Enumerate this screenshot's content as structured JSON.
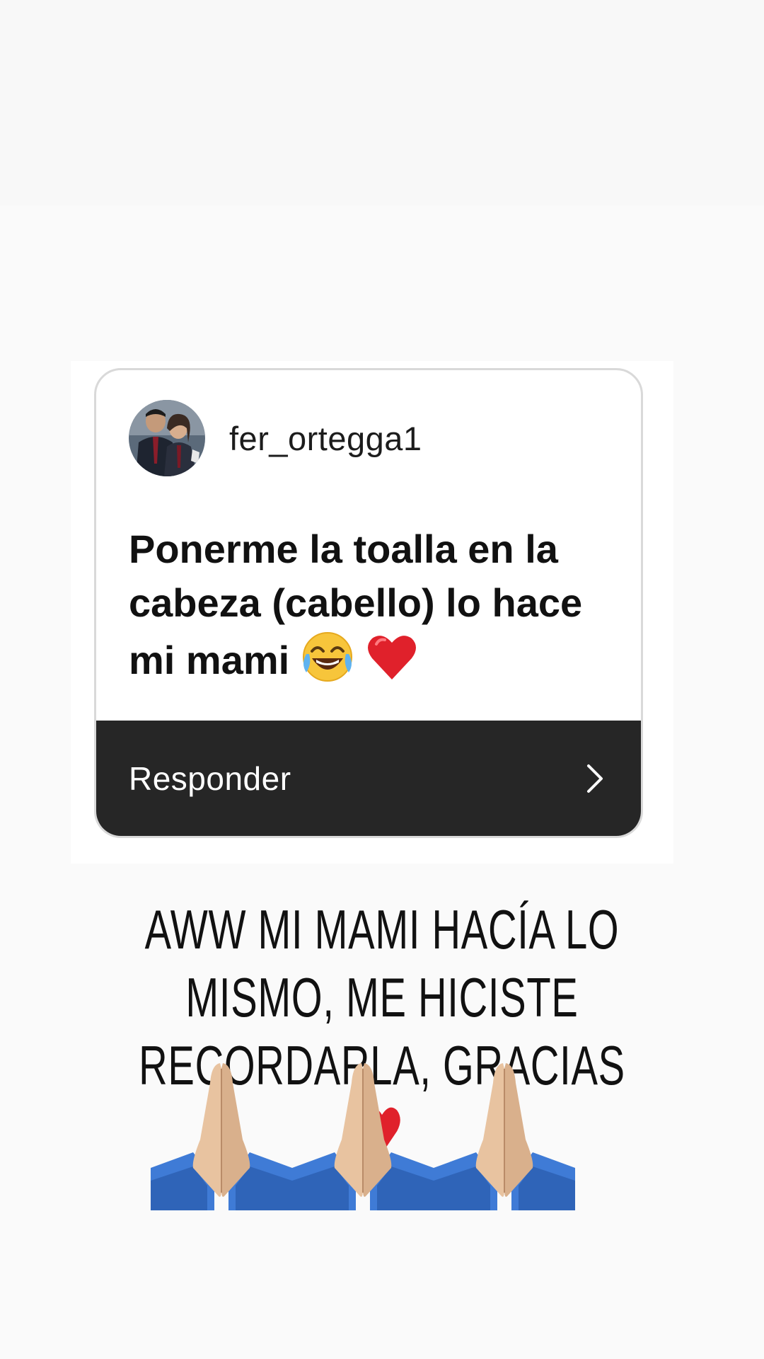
{
  "question_card": {
    "username": "fer_ortegga1",
    "question_text": "Ponerme la toalla en la cabeza (cabello) lo hace mi mami",
    "emojis": [
      "joy-face-icon",
      "red-heart-icon"
    ],
    "reply_label": "Responder",
    "reply_icon": "chevron-right-icon"
  },
  "caption": {
    "text": "AWW MI MAMI HACÍA LO MISMO, ME HICISTE RECORDARLA, GRACIAS",
    "emoji": "red-heart-icon"
  },
  "decorations": {
    "hands_count": 3,
    "hands_icon": "folded-hands-icon"
  },
  "colors": {
    "reply_bar": "#262626",
    "card_border": "#d9d9d9",
    "heart": "#e0212b",
    "sleeve": "#3f7bd6"
  }
}
